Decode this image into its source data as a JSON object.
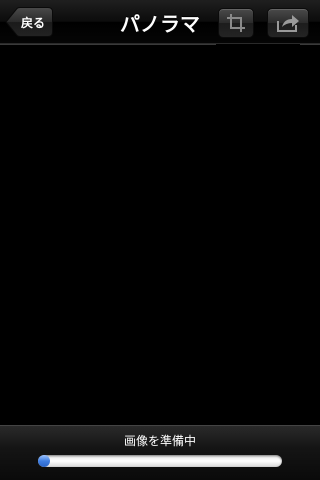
{
  "navbar": {
    "back_label": "戻る",
    "title": "パノラマ",
    "crop_icon": "crop-icon",
    "share_icon": "share-icon"
  },
  "status": {
    "text": "画像を準備中",
    "progress": 0.05
  },
  "colors": {
    "background": "#000000",
    "progress_fill": "#3f7fe3",
    "progress_track": "#ffffff"
  }
}
